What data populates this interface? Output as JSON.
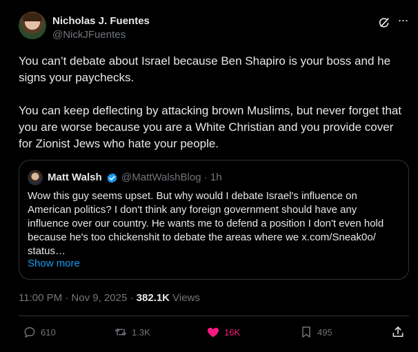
{
  "author": {
    "name": "Nicholas J. Fuentes",
    "handle": "@NickJFuentes"
  },
  "tweet": {
    "paragraph1": "You can’t debate about Israel because Ben Shapiro is your boss and he signs your paychecks.",
    "paragraph2": "You can keep deflecting by attacking brown Muslims, but never forget that you are worse because you are a White Christian and you provide cover for Zionist Jews who hate your people."
  },
  "quoted": {
    "name": "Matt Walsh",
    "handle_time": "@MattWalshBlog · 1h",
    "text": "Wow this guy seems upset. But why would I debate Israel's influence on American politics? I don't think any foreign government should have any influence over our country. He wants me to defend a position I don't even hold because he's too chickenshit to debate the areas where we x.com/Sneak0o/ status…",
    "show_more": "Show more"
  },
  "meta": {
    "timestamp": "11:00 PM · Nov 9, 2025 · ",
    "views_count": "382.1K",
    "views_label": " Views"
  },
  "actions": {
    "replies": "610",
    "reposts": "1.3K",
    "likes": "16K",
    "bookmarks": "495"
  },
  "icons": {
    "grok": "grok-icon",
    "more": "more-icon",
    "verified": "verified-badge-icon",
    "reply": "reply-icon",
    "repost": "repost-icon",
    "like": "heart-icon",
    "bookmark": "bookmark-icon",
    "share": "share-icon"
  },
  "colors": {
    "background": "#000000",
    "text": "#e7e9ea",
    "muted": "#71767b",
    "link": "#1d9bf0",
    "like": "#f91880",
    "border": "#2f3336"
  }
}
